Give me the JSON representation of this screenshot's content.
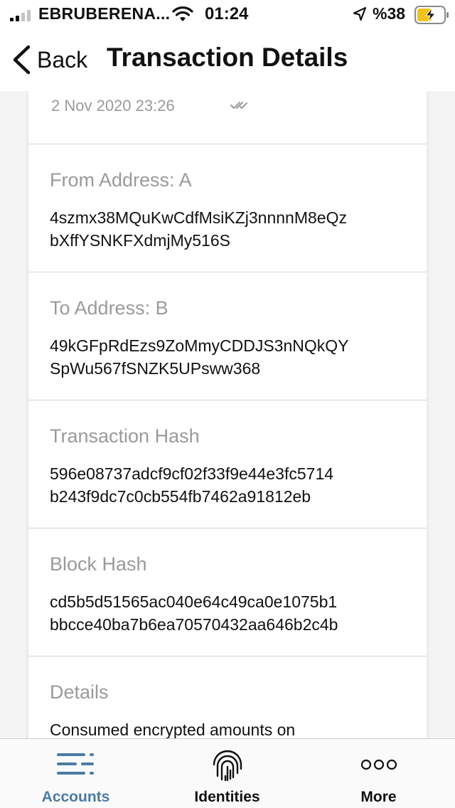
{
  "status_bar": {
    "carrier": "EBRUBERENA...",
    "time": "01:24",
    "battery_percent": "%38",
    "icons": [
      "signal-icon",
      "wifi-icon",
      "location-arrow-icon",
      "battery-charging-icon"
    ]
  },
  "nav": {
    "back_label": "Back",
    "title": "Transaction Details"
  },
  "transaction": {
    "date": "2 Nov 2020 23:26",
    "from_label": "From Address: A",
    "from_value_line1": "4szmx38MQuKwCdfMsiKZj3nnnnM8eQz",
    "from_value_line2": "bXffYSNKFXdmjMy516S",
    "to_label": "To Address: B",
    "to_value_line1": "49kGFpRdEzs9ZoMmyCDDJS3nNQkQY",
    "to_value_line2": "SpWu567fSNZK5UPsww368",
    "tx_hash_label": "Transaction Hash",
    "tx_hash_line1": "596e08737adcf9cf02f33f9e44e3fc5714",
    "tx_hash_line2": "b243f9dc7c0cb554fb7462a91812eb",
    "block_hash_label": "Block Hash",
    "block_hash_line1": "cd5b5d51565ac040e64c49ca0e1075b1",
    "block_hash_line2": "bbcce40ba7b6ea70570432aa646b2c4b",
    "details_label": "Details",
    "details_value": "Consumed encrypted amounts on"
  },
  "tabs": [
    {
      "label": "Accounts",
      "icon": "accounts-list-icon",
      "active": true
    },
    {
      "label": "Identities",
      "icon": "fingerprint-icon",
      "active": false
    },
    {
      "label": "More",
      "icon": "more-dots-icon",
      "active": false
    }
  ],
  "colors": {
    "active_tab": "#4a7ba6",
    "inactive_tab": "#111111",
    "label_gray": "#9a9a9a"
  }
}
